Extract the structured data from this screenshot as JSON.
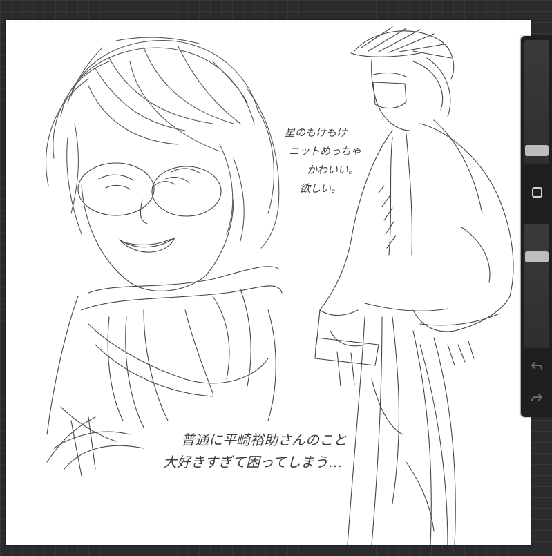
{
  "canvas": {
    "background": "#ffffff",
    "stroke_color": "#3d4a3f",
    "notes": {
      "top_right": [
        "星のもけもけ",
        "ニットめっちゃ",
        "かわいい。",
        "欲しい。"
      ],
      "bottom": [
        "普通に平崎裕助さんのこと",
        "大好きすぎて困ってしまう…"
      ]
    }
  },
  "sidebar": {
    "brush_size_level": 0.92,
    "brush_opacity_level": 0.77,
    "icons": {
      "modify": "square-icon",
      "undo": "undo-icon",
      "redo": "redo-icon"
    }
  },
  "colors": {
    "app_background": "#2b2b2d",
    "sidebar": "#1f1f20",
    "thumb": "#bdbdbd"
  }
}
